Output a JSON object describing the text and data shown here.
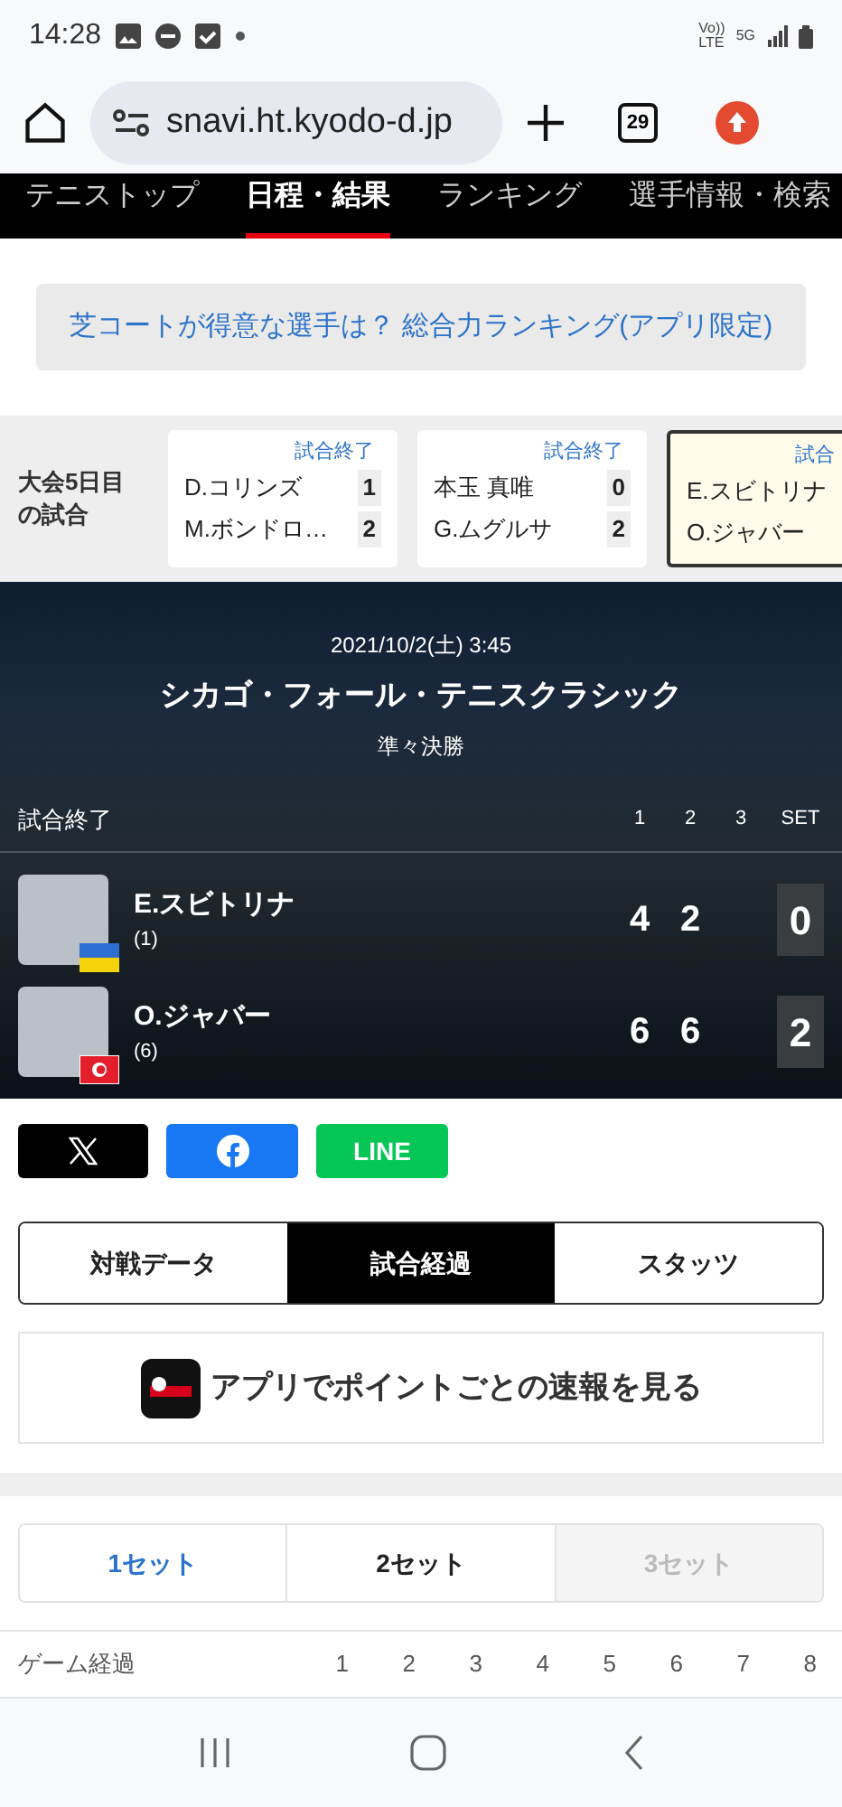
{
  "status_bar": {
    "time": "14:28",
    "volte": [
      "Vo))",
      "LTE"
    ],
    "network": "5G"
  },
  "browser": {
    "url": "snavi.ht.kyodo-d.jp",
    "tab_count": "29"
  },
  "nav_tabs": [
    {
      "label": "テニストップ",
      "selected": false
    },
    {
      "label": "日程・結果",
      "selected": true
    },
    {
      "label": "ランキング",
      "selected": false
    },
    {
      "label": "選手情報・検索",
      "selected": false
    }
  ],
  "promo_link": "芝コートが得意な選手は？ 総合力ランキング(アプリ限定)",
  "match_strip": {
    "label": "大会5日目の試合",
    "matches": [
      {
        "status": "試合終了",
        "selected": false,
        "players": [
          {
            "name": "D.コリンズ",
            "score": "1"
          },
          {
            "name": "M.ボンドロ…",
            "score": "2"
          }
        ]
      },
      {
        "status": "試合終了",
        "selected": false,
        "players": [
          {
            "name": "本玉 真唯",
            "score": "0"
          },
          {
            "name": "G.ムグルサ",
            "score": "2"
          }
        ]
      },
      {
        "status": "試合",
        "selected": true,
        "players": [
          {
            "name": "E.スビトリナ"
          },
          {
            "name": "O.ジャバー"
          }
        ]
      }
    ]
  },
  "scoreboard": {
    "datetime": "2021/10/2(土) 3:45",
    "tournament": "シカゴ・フォール・テニスクラシック",
    "round": "準々決勝",
    "status": "試合終了",
    "columns": [
      "1",
      "2",
      "3",
      "SET"
    ],
    "players": [
      {
        "name": "E.スビトリナ",
        "seed": "(1)",
        "kind": "ua",
        "games": [
          "4",
          "2"
        ],
        "sets": "0"
      },
      {
        "name": "O.ジャバー",
        "seed": "(6)",
        "kind": "tn",
        "games": [
          "6",
          "6"
        ],
        "sets": "2"
      }
    ]
  },
  "share": {
    "line": "LINE"
  },
  "tabs": [
    {
      "label": "対戦データ",
      "selected": false
    },
    {
      "label": "試合経過",
      "selected": true
    },
    {
      "label": "スタッツ",
      "selected": false
    }
  ],
  "app_banner": "アプリでポイントごとの速報を見る",
  "set_tabs": [
    {
      "label": "1セット",
      "selected": true,
      "disabled": false
    },
    {
      "label": "2セット",
      "selected": false,
      "disabled": false
    },
    {
      "label": "3セット",
      "selected": false,
      "disabled": true
    }
  ],
  "game_progress": {
    "label": "ゲーム経過",
    "columns": [
      "1",
      "2",
      "3",
      "4",
      "5",
      "6",
      "7",
      "8"
    ]
  }
}
